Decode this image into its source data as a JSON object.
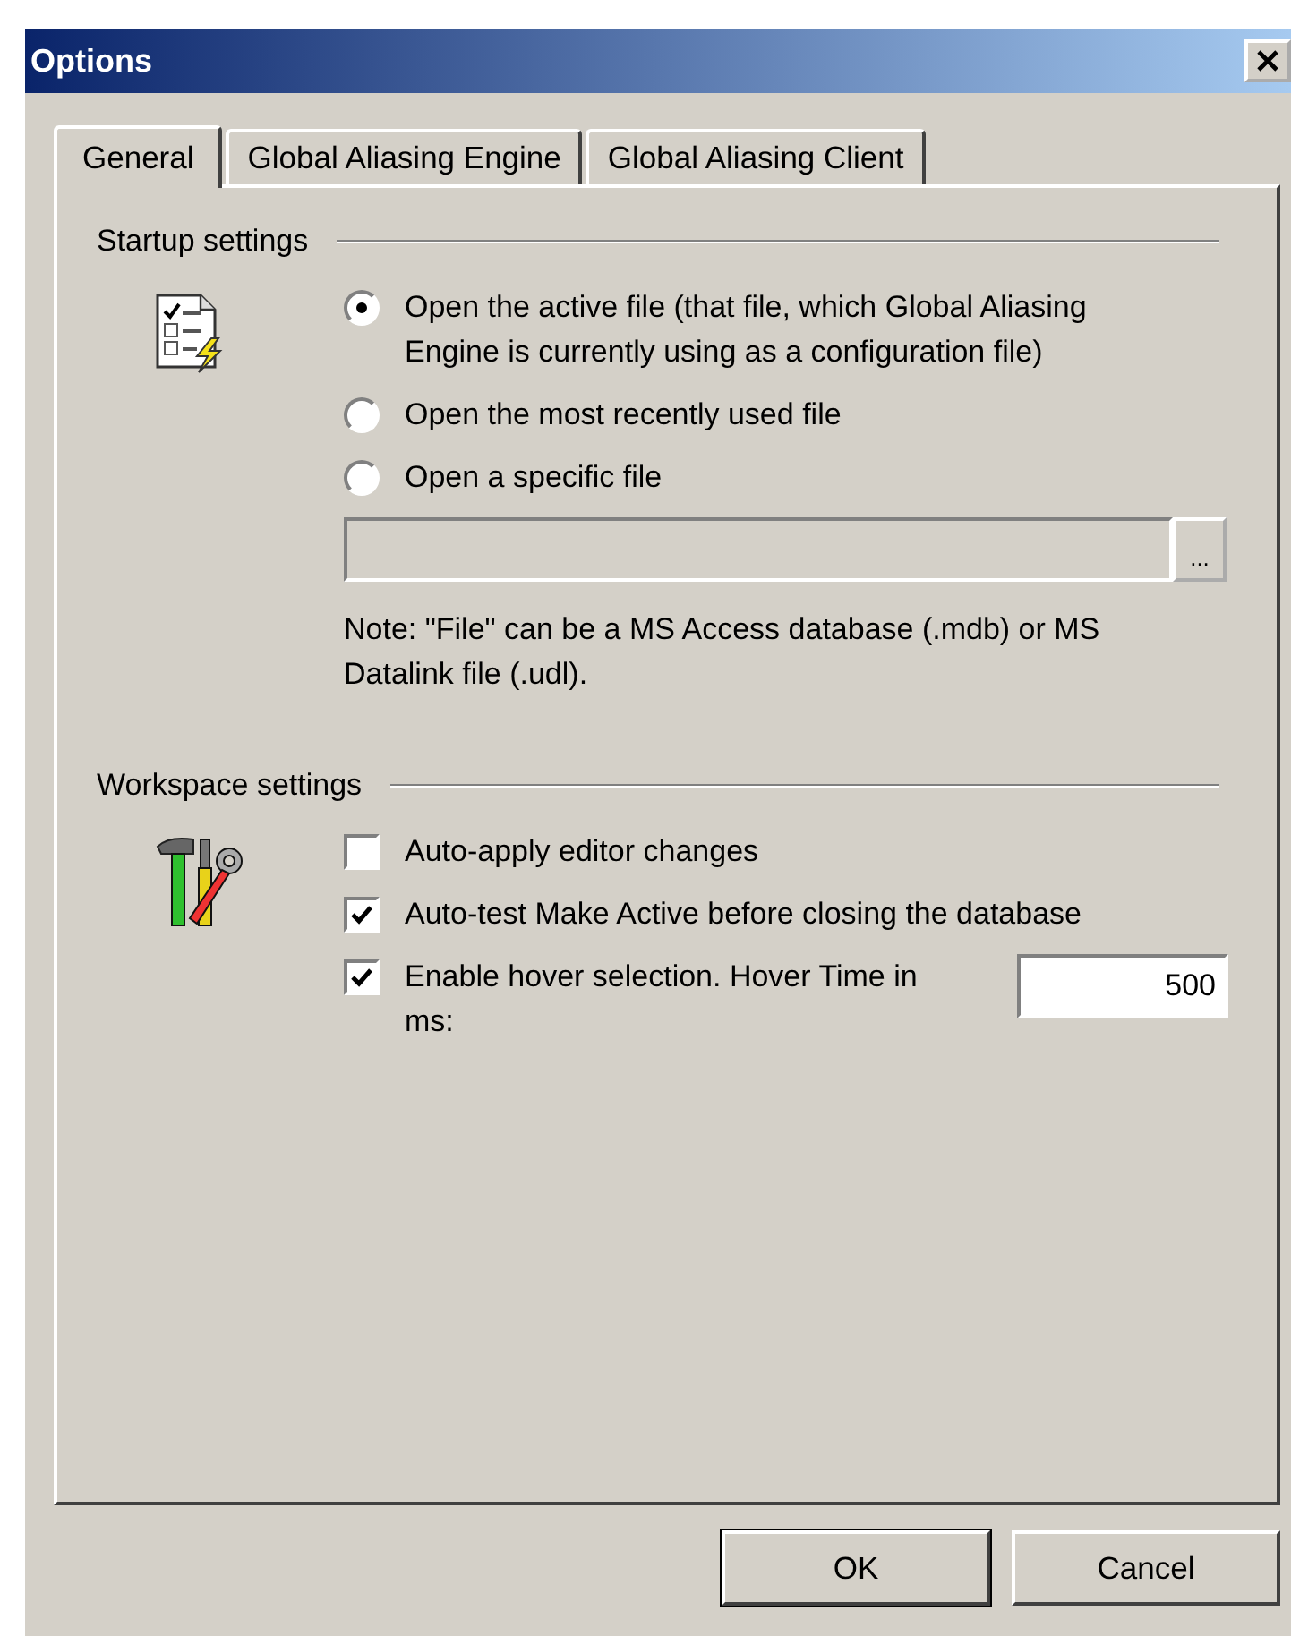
{
  "window": {
    "title": "Options"
  },
  "tabs": [
    {
      "label": "General",
      "selected": true
    },
    {
      "label": "Global Aliasing Engine",
      "selected": false
    },
    {
      "label": "Global Aliasing Client",
      "selected": false
    }
  ],
  "startup": {
    "heading": "Startup settings",
    "options": [
      {
        "label": "Open the active file (that file, which Global Aliasing Engine is currently using as a configuration file)",
        "selected": true
      },
      {
        "label": "Open the most recently used file",
        "selected": false
      },
      {
        "label": "Open a specific file",
        "selected": false
      }
    ],
    "file_field": {
      "disabled": true,
      "browse_label": "..."
    },
    "note": "Note: \"File\" can be a MS Access database (.mdb) or MS Datalink file (.udl)."
  },
  "workspace": {
    "heading": "Workspace settings",
    "options": [
      {
        "label": "Auto-apply editor changes",
        "checked": false
      },
      {
        "label": "Auto-test Make Active before closing the database",
        "checked": true
      },
      {
        "label": "Enable hover selection. Hover Time in ms:",
        "checked": true
      }
    ],
    "hover_time_field": {
      "value": "500"
    }
  },
  "buttons": [
    {
      "label": "OK",
      "default": true
    },
    {
      "label": "Cancel",
      "default": false
    }
  ]
}
